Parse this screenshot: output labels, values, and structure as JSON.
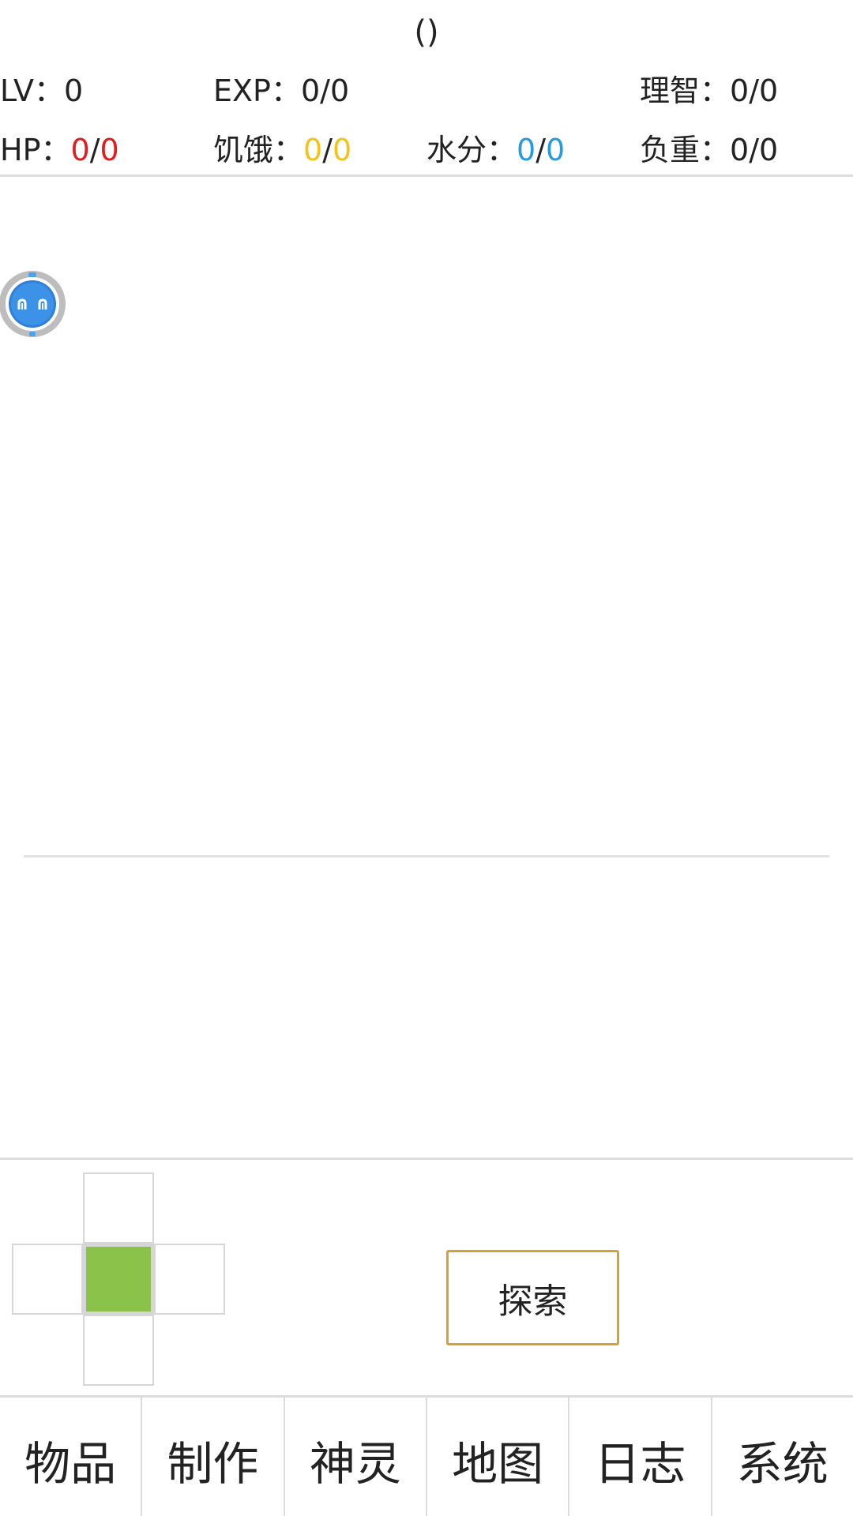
{
  "header": {
    "title": "()"
  },
  "stats": {
    "lv_label": "LV：",
    "lv_value": "0",
    "exp_label": "EXP：",
    "exp_value": "0/0",
    "sanity_label": "理智：",
    "sanity_value": "0/0",
    "hp_label": "HP：",
    "hp_current": "0",
    "hp_max": "0",
    "hunger_label": "饥饿：",
    "hunger_current": "0",
    "hunger_max": "0",
    "water_label": "水分：",
    "water_current": "0",
    "water_max": "0",
    "weight_label": "负重：",
    "weight_value": "0/0",
    "separator": "/"
  },
  "colors": {
    "hp": "#e01e1e",
    "hunger": "#f3c318",
    "water": "#2a9ae0",
    "current_cell": "#8bc34a",
    "explore_border": "#d4a232"
  },
  "avatar": {
    "icon": "blue-bot-avatar-icon"
  },
  "actions": {
    "explore_label": "探索"
  },
  "tabs": [
    {
      "label": "物品"
    },
    {
      "label": "制作"
    },
    {
      "label": "神灵"
    },
    {
      "label": "地图"
    },
    {
      "label": "日志"
    },
    {
      "label": "系统"
    }
  ]
}
